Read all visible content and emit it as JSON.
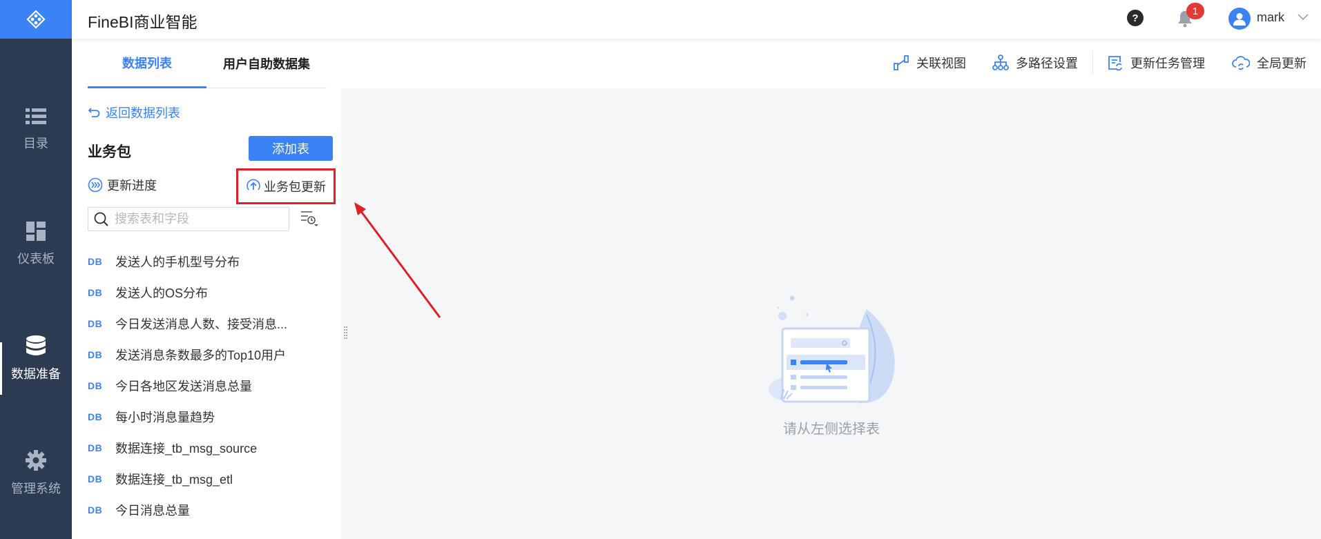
{
  "app": {
    "title": "FineBI商业智能"
  },
  "header": {
    "help_symbol": "?",
    "notification_count": "1",
    "username": "mark"
  },
  "nav": {
    "items": [
      {
        "label": "目录",
        "icon": "list-icon",
        "active": false
      },
      {
        "label": "仪表板",
        "icon": "dashboard-icon",
        "active": false
      },
      {
        "label": "数据准备",
        "icon": "database-icon",
        "active": true
      },
      {
        "label": "管理系统",
        "icon": "gear-icon",
        "active": false
      }
    ]
  },
  "tabs": [
    {
      "label": "数据列表",
      "active": true
    },
    {
      "label": "用户自助数据集",
      "active": false
    }
  ],
  "toolbar": {
    "relation_view": "关联视图",
    "multipath": "多路径设置",
    "task_manage": "更新任务管理",
    "global_update": "全局更新"
  },
  "panel": {
    "back_label": "返回数据列表",
    "package_title": "业务包",
    "add_table_label": "添加表",
    "progress_label": "更新进度",
    "package_update_label": "业务包更新",
    "search_placeholder": "搜索表和字段",
    "db_tag": "DB",
    "tables": [
      "发送人的手机型号分布",
      "发送人的OS分布",
      "今日发送消息人数、接受消息...",
      "发送消息条数最多的Top10用户",
      "今日各地区发送消息总量",
      "每小时消息量趋势",
      "数据连接_tb_msg_source",
      "数据连接_tb_msg_etl",
      "今日消息总量"
    ]
  },
  "main": {
    "empty_message": "请从左侧选择表"
  },
  "colors": {
    "accent": "#3b82f6",
    "nav_bg": "#2c3a52",
    "highlight_box": "#e01e26"
  }
}
